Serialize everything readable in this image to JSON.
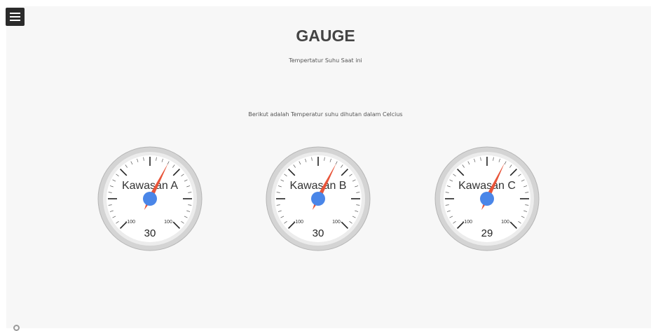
{
  "header": {
    "menu_icon": "hamburger-menu-icon",
    "title": "GAUGE",
    "subtitle": "Tempertatur Suhu Saat ini"
  },
  "main": {
    "description": "Berikut adalah Temperatur suhu dihutan dalam Celcius"
  },
  "gauges": [
    {
      "label": "Kawasan A",
      "value": "30",
      "min_label": "-100",
      "max_label": "100"
    },
    {
      "label": "Kawasan B",
      "value": "30",
      "min_label": "-100",
      "max_label": "100"
    },
    {
      "label": "Kawasan C",
      "value": "29",
      "min_label": "-100",
      "max_label": "100"
    }
  ],
  "colors": {
    "page_background": "#f7f7f7",
    "gauge_face": "#ffffff",
    "gauge_rim": "#bdbdbd",
    "needle": "#e8553a",
    "needle_hub": "#4a86e8",
    "tick": "#222222"
  }
}
